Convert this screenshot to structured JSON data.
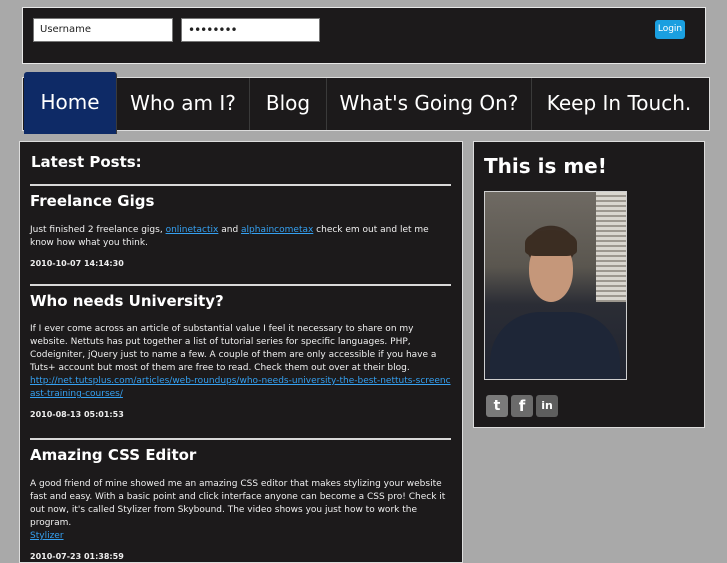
{
  "login": {
    "username_placeholder": "Username",
    "password_value": "••••••••",
    "button_label": "Login"
  },
  "nav": {
    "items": [
      "Home",
      "Who am I?",
      "Blog",
      "What's Going On?",
      "Keep In Touch."
    ],
    "active": "Home"
  },
  "main": {
    "heading": "Latest Posts:",
    "posts": [
      {
        "title": "Freelance Gigs",
        "body_pre": "Just finished 2 freelance gigs, ",
        "link1": "onlinetactix",
        "body_mid": " and ",
        "link2": "alphaincometax",
        "body_post": " check em out and let me know how what you think.",
        "date": "2010-10-07 14:14:30"
      },
      {
        "title": "Who needs University?",
        "body": "If I ever come across an article of substantial value I feel it necessary to share on my website. Nettuts has put together a list of tutorial series for specific languages. PHP, Codeigniter, jQuery just to name a few. A couple of them are only accessible if you have a Tuts+ account but most of them are free to read. Check them out over at their blog.",
        "link": "http://net.tutsplus.com/articles/web-roundups/who-needs-university-the-best-nettuts-screencast-training-courses/",
        "date": "2010-08-13 05:01:53"
      },
      {
        "title": "Amazing CSS Editor",
        "body": "A good friend of mine showed me an amazing CSS editor that makes stylizing your website fast and easy. With a basic point and click interface anyone can become a CSS pro! Check it out now, it's called Stylizer from Skybound. The video shows you just how to work the program.",
        "link": "Stylizer",
        "date": "2010-07-23 01:38:59"
      }
    ]
  },
  "sidebar": {
    "heading": "This is me!",
    "social": [
      {
        "name": "twitter-icon",
        "glyph": "t",
        "color": "#7a7a7a"
      },
      {
        "name": "facebook-icon",
        "glyph": "f",
        "color": "#6b6b6b"
      },
      {
        "name": "linkedin-icon",
        "glyph": "in",
        "color": "#5e5e5e"
      }
    ]
  },
  "colors": {
    "page_bg": "#a9a9a9",
    "panel_bg": "#1c1a1b",
    "nav_active": "#0e2a66",
    "link": "#35a0f0",
    "login_button": "#1a9fe0"
  }
}
